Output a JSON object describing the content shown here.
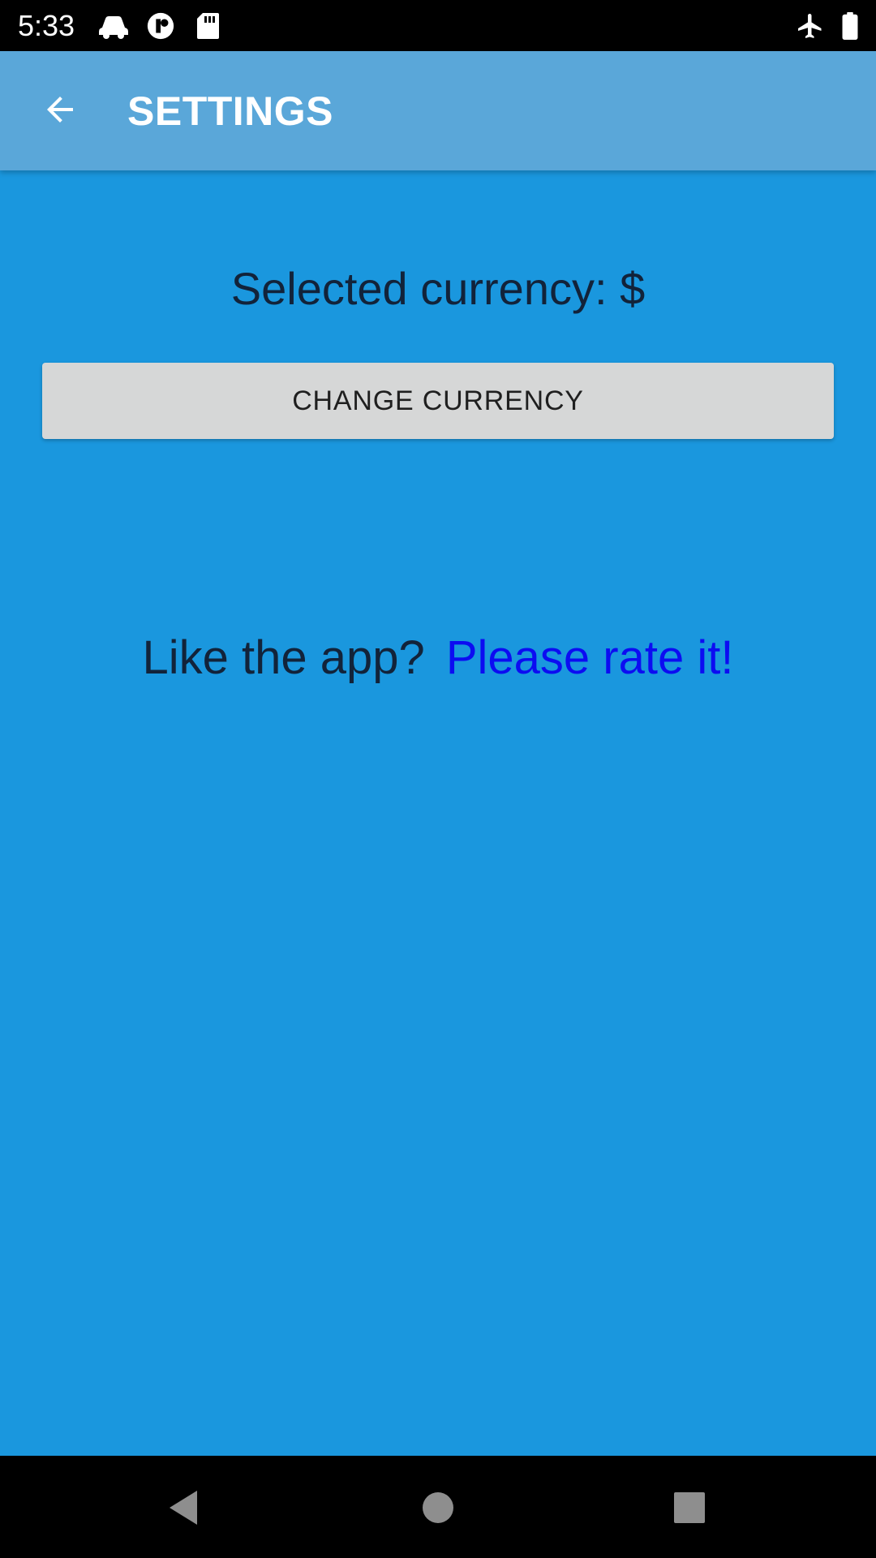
{
  "status_bar": {
    "time": "5:33",
    "left_icons": [
      "car-icon",
      "sync-app-icon",
      "sd-card-icon"
    ],
    "right_icons": [
      "airplane-mode-icon",
      "battery-icon"
    ]
  },
  "app_bar": {
    "back_icon": "arrow-back-icon",
    "title": "SETTINGS",
    "background": "#5aa7d9"
  },
  "settings": {
    "currency_label": "Selected currency: $",
    "change_currency_button": "CHANGE CURRENCY",
    "rate_prompt": "Like the app?",
    "rate_link": "Please rate it!"
  },
  "nav_bar": {
    "buttons": [
      "back-triangle-icon",
      "home-circle-icon",
      "recents-square-icon"
    ]
  },
  "colors": {
    "background": "#1a97de",
    "link": "#0c0cf2",
    "text": "#12233a",
    "button": "#d6d7d7"
  }
}
